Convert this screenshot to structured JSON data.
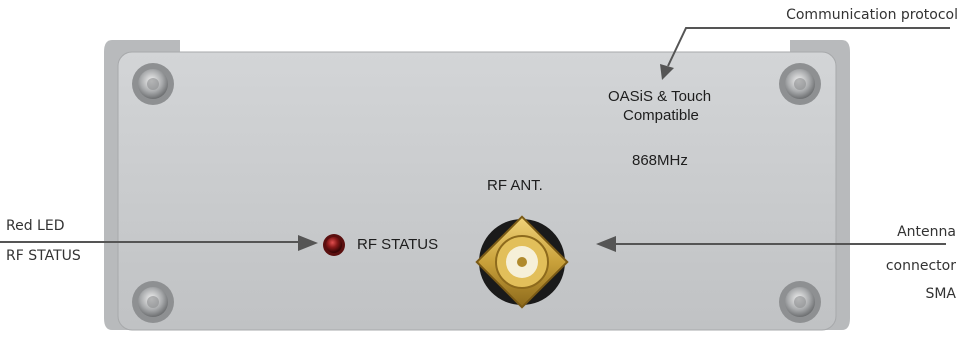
{
  "callouts": {
    "protocol": "Communication protocol",
    "led_line1": "Red LED",
    "led_line2": "RF STATUS",
    "antenna_line1": "Antenna",
    "antenna_line2": "connector",
    "antenna_line3": "SMA"
  },
  "panel": {
    "compat_line1": "OASiS & Touch",
    "compat_line2": "Compatible",
    "frequency": "868MHz",
    "antenna_label": "RF ANT.",
    "status_label": "RF STATUS"
  },
  "colors": {
    "panel": "#c9cbcd",
    "led": "#8a1a1a",
    "connector_gold": "#c9a13a",
    "arrow": "#555555"
  }
}
